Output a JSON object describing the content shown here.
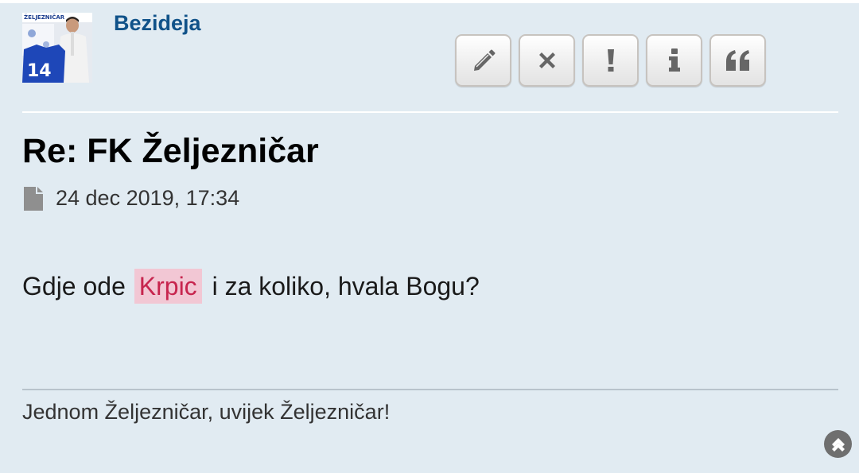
{
  "post": {
    "author": "Bezideja",
    "title": "Re: FK Željezničar",
    "timestamp": "24 dec 2019, 17:34",
    "content_before": "Gdje ode",
    "content_highlight": "Krpic",
    "content_after": "i za koliko, hvala Bogu?",
    "signature": "Jednom Željezničar, uvijek Željezničar!"
  },
  "avatar": {
    "banner_text": "ŽELJEZNIČAR",
    "jersey_number": "14"
  },
  "buttons": [
    {
      "name": "edit",
      "icon": "pencil-icon"
    },
    {
      "name": "delete",
      "icon": "close-icon"
    },
    {
      "name": "report",
      "icon": "exclamation-icon"
    },
    {
      "name": "info",
      "icon": "info-icon"
    },
    {
      "name": "quote",
      "icon": "quote-icon"
    }
  ],
  "colors": {
    "post_bg": "#e1ebf2",
    "username": "#105289",
    "highlight_bg": "#f2c7d4",
    "highlight_text": "#c7254e",
    "icon": "#666666"
  }
}
